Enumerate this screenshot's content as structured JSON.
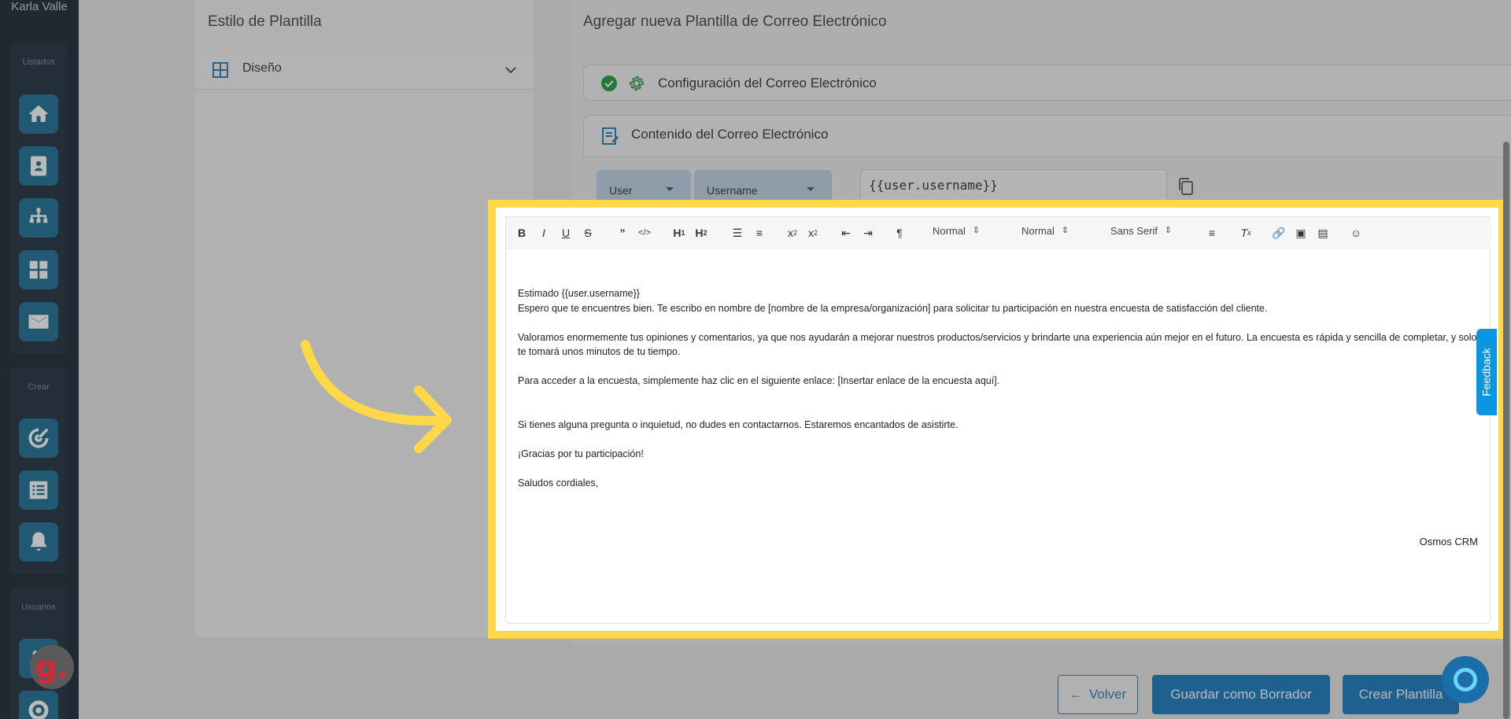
{
  "sidebar": {
    "user_name": "Karla Valle",
    "sections": [
      {
        "title": "Listados"
      },
      {
        "title": "Crear"
      },
      {
        "title": "Usuarios"
      }
    ]
  },
  "template_style": {
    "title": "Estilo de Plantilla",
    "design_label": "Diseño"
  },
  "page": {
    "title": "Agregar nueva Plantilla de Correo Electrónico",
    "config_label": "Configuración del Correo Electrónico",
    "content_label": "Contenido del Correo Electrónico"
  },
  "variables": {
    "group": "User",
    "field": "Username",
    "value": "{{user.username}}"
  },
  "toolbar": {
    "header_select": "Normal",
    "size_select": "Normal",
    "font_select": "Sans Serif"
  },
  "email": {
    "lines": [
      "Estimado {{user.username}}",
      "Espero que te encuentres bien. Te escribo en nombre de [nombre de la empresa/organización] para solicitar tu participación en nuestra encuesta de satisfacción del cliente.",
      "",
      "Valoramos enormemente tus opiniones y comentarios, ya que nos ayudarán a mejorar nuestros productos/servicios y brindarte una experiencia aún mejor en el futuro. La encuesta es rápida y sencilla de completar, y solo te tomará unos minutos de tu tiempo.",
      "",
      "Para acceder a la encuesta, simplemente haz clic en el siguiente enlace: [Insertar enlace de la encuesta aquí].",
      "",
      "",
      "Si tienes alguna pregunta o inquietud, no dudes en contactarnos. Estaremos encantados de asistirte.",
      "",
      "¡Gracias por tu participación!",
      "",
      "Saludos cordiales,"
    ],
    "signature": "Osmos CRM"
  },
  "buttons": {
    "back": "Volver",
    "save_draft": "Guardar como Borrador",
    "create": "Crear Plantilla"
  },
  "feedback_label": "Feedback",
  "colors": {
    "highlight": "#ffd84a",
    "primary": "#1e6f96",
    "feedback": "#0d96e0"
  }
}
